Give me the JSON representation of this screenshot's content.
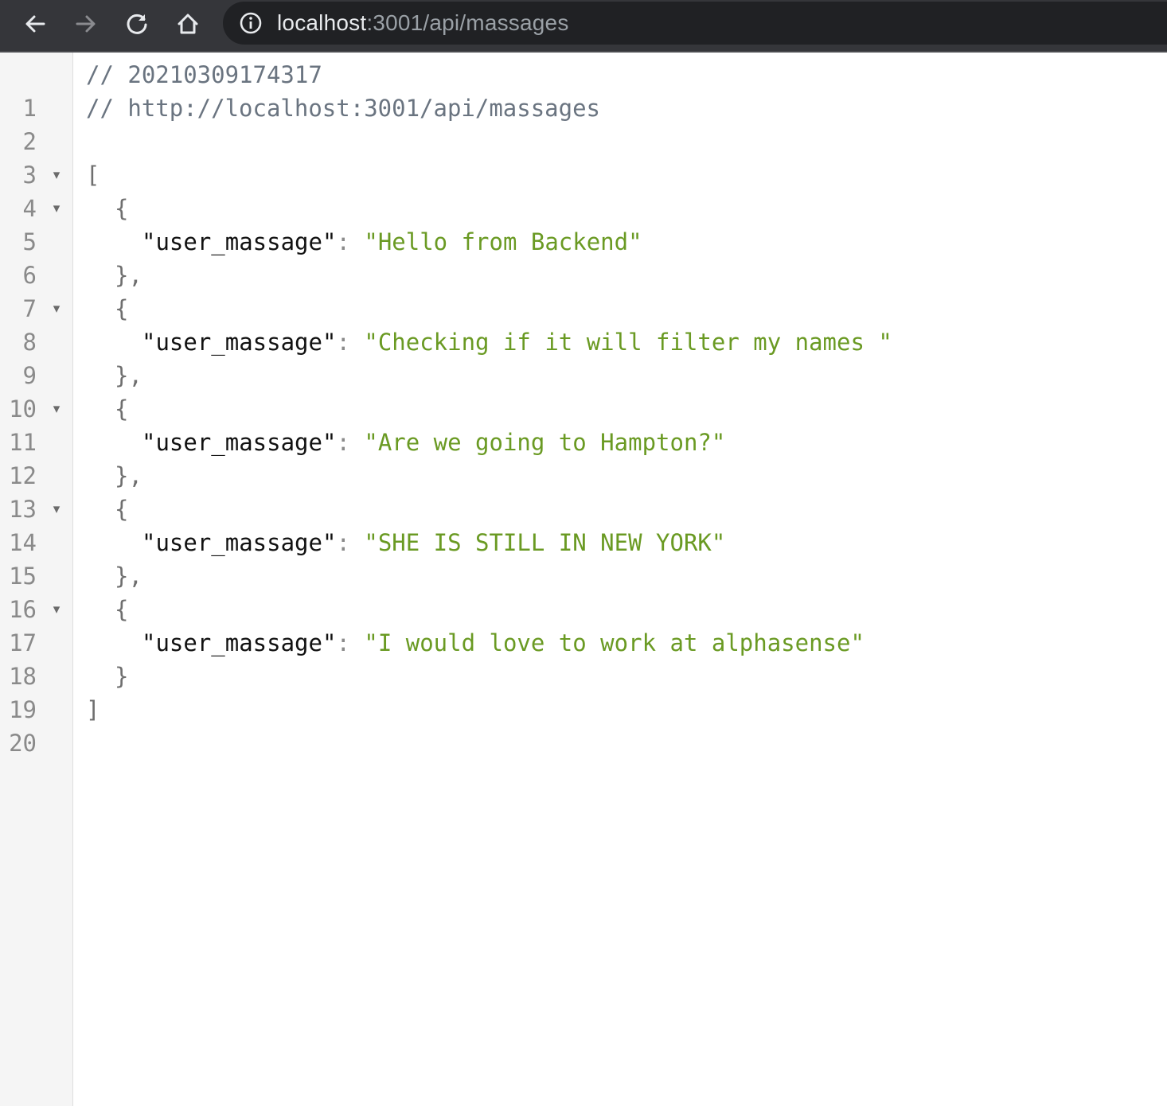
{
  "browser": {
    "url_host": "localhost",
    "url_path": ":3001/api/massages",
    "nav_icons": [
      "back-arrow-icon",
      "forward-arrow-icon",
      "reload-icon",
      "home-icon",
      "info-icon"
    ]
  },
  "viewer": {
    "line_numbers": [
      "1",
      "2",
      "3",
      "4",
      "5",
      "6",
      "7",
      "8",
      "9",
      "10",
      "11",
      "12",
      "13",
      "14",
      "15",
      "16",
      "17",
      "18",
      "19",
      "20"
    ],
    "fold_marker": "▾",
    "comments": {
      "timestamp": "// 20210309174317",
      "url": "// http://localhost:3001/api/massages"
    },
    "punctuation": {
      "array_open": "[",
      "array_close": "]",
      "object_open": "{",
      "object_close_comma": "},",
      "object_close": "}",
      "colon": ":"
    },
    "key_name": "\"user_massage\"",
    "messages": [
      "\"Hello from Backend\"",
      "\"Checking if it will filter my names \"",
      "\"Are we going to Hampton?\"",
      "\"SHE IS STILL IN NEW YORK\"",
      "\"I would love to work at alphasense\""
    ]
  },
  "colors": {
    "toolbar": "#35363a",
    "omnibox": "#202124",
    "string": "#6a9a23",
    "comment": "#6a7480",
    "key": "#111111"
  }
}
